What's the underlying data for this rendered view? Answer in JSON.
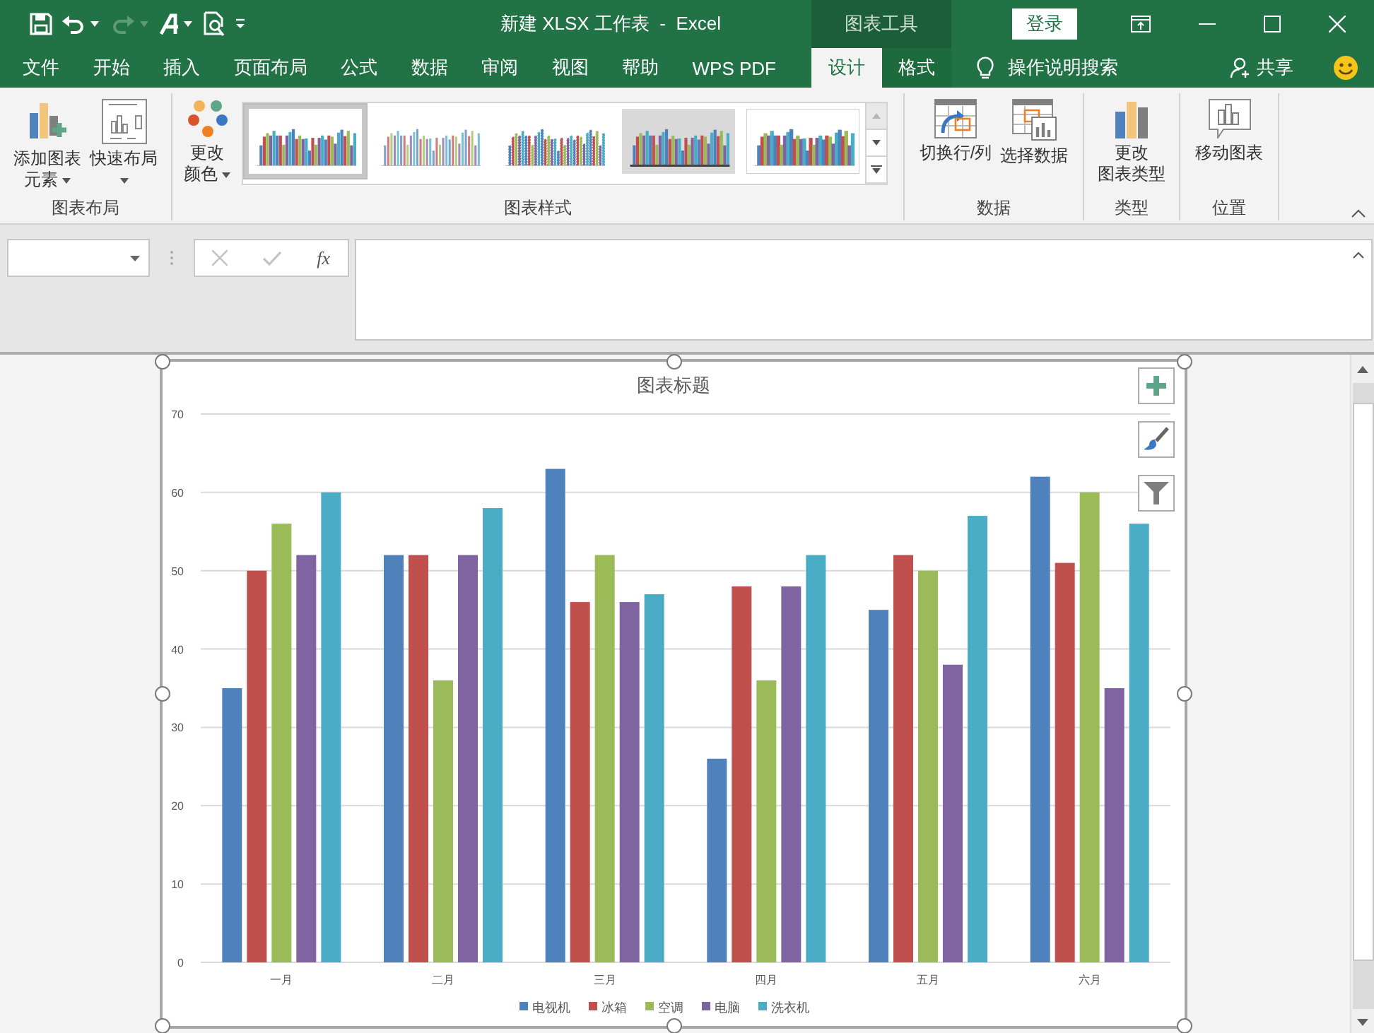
{
  "title_bar": {
    "title": "新建 XLSX 工作表  -  Excel",
    "context_group": "图表工具",
    "sign_in": "登录"
  },
  "tabs": [
    {
      "label": "文件",
      "selected": false
    },
    {
      "label": "开始",
      "selected": false
    },
    {
      "label": "插入",
      "selected": false
    },
    {
      "label": "页面布局",
      "selected": false
    },
    {
      "label": "公式",
      "selected": false
    },
    {
      "label": "数据",
      "selected": false
    },
    {
      "label": "审阅",
      "selected": false
    },
    {
      "label": "视图",
      "selected": false
    },
    {
      "label": "帮助",
      "selected": false
    },
    {
      "label": "WPS PDF",
      "selected": false
    }
  ],
  "context_tabs": [
    {
      "label": "设计",
      "selected": true
    },
    {
      "label": "格式",
      "selected": false
    }
  ],
  "tell_me": "操作说明搜索",
  "share": "共享",
  "ribbon": {
    "groups": [
      {
        "label": "图表布局",
        "buttons": [
          {
            "kind": "add-element",
            "lines": [
              "添加图表",
              "元素"
            ],
            "dropdown": true
          },
          {
            "kind": "quick-layout",
            "lines": [
              "快速布局"
            ],
            "dropdown": true
          }
        ]
      },
      {
        "label": "图表样式",
        "buttons": [
          {
            "kind": "colors",
            "lines": [
              "更改",
              "颜色"
            ],
            "dropdown": true
          }
        ],
        "gallery": [
          {
            "kind": "plain",
            "selected": true
          },
          {
            "kind": "thin",
            "selected": false
          },
          {
            "kind": "dashed",
            "selected": false
          },
          {
            "kind": "gray",
            "selected": false
          },
          {
            "kind": "wide",
            "selected": false
          }
        ]
      },
      {
        "label": "数据",
        "buttons": [
          {
            "kind": "switch",
            "lines": [
              "切换行/列"
            ],
            "dropdown": false
          },
          {
            "kind": "select-data",
            "lines": [
              "选择数据"
            ],
            "dropdown": false
          }
        ]
      },
      {
        "label": "类型",
        "buttons": [
          {
            "kind": "change-type",
            "lines": [
              "更改",
              "图表类型"
            ],
            "dropdown": false
          }
        ]
      },
      {
        "label": "位置",
        "buttons": [
          {
            "kind": "move",
            "lines": [
              "移动图表"
            ],
            "dropdown": false
          }
        ]
      }
    ]
  },
  "formula_bar": {
    "function_label": "fx"
  },
  "chart_data": {
    "type": "bar",
    "title": "图表标题",
    "grid": true,
    "legend": true,
    "categories": [
      "一月",
      "二月",
      "三月",
      "四月",
      "五月",
      "六月"
    ],
    "ylim": [
      0,
      70
    ],
    "yticks": [
      0,
      10,
      20,
      30,
      40,
      50,
      60,
      70
    ],
    "series": [
      {
        "name": "电视机",
        "color": "#4f81bd",
        "values": [
          35,
          52,
          63,
          26,
          45,
          62
        ]
      },
      {
        "name": "冰箱",
        "color": "#c0504d",
        "values": [
          50,
          52,
          46,
          48,
          52,
          51
        ]
      },
      {
        "name": "空调",
        "color": "#9bbb59",
        "values": [
          56,
          36,
          52,
          36,
          50,
          60
        ]
      },
      {
        "name": "电脑",
        "color": "#8064a2",
        "values": [
          52,
          52,
          46,
          48,
          38,
          35
        ]
      },
      {
        "name": "洗衣机",
        "color": "#4bacc6",
        "values": [
          60,
          58,
          47,
          52,
          57,
          56
        ]
      }
    ]
  }
}
